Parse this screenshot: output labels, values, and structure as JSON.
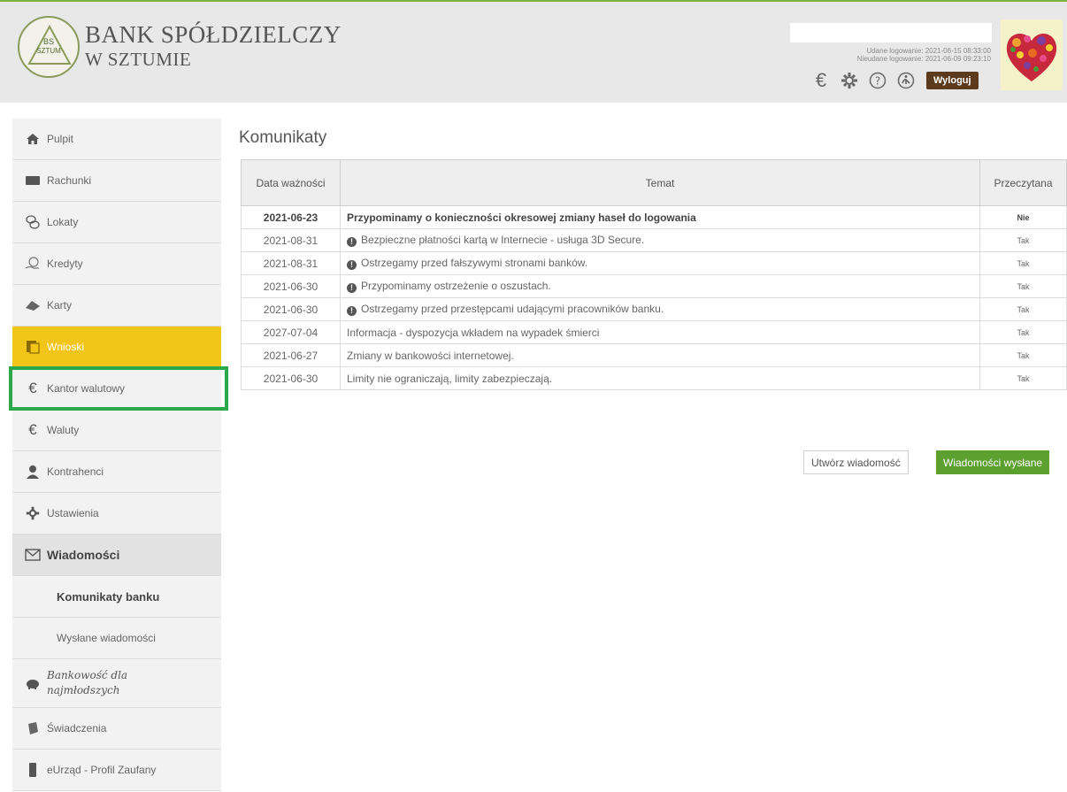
{
  "header": {
    "logo_line1": "BS",
    "logo_line2": "SZTUM",
    "bank_name_line1": "BANK SPÓŁDZIELCZY",
    "bank_name_line2": "W SZTUMIE",
    "login_success": "Udane logowanie: 2021-06-15 08:33:00",
    "login_failed": "Nieudane logowanie: 2021-06-09 09:23:10",
    "logout_label": "Wyloguj",
    "icons": [
      "euro-icon",
      "gear-icon",
      "help-icon",
      "accessibility-icon"
    ]
  },
  "sidebar": {
    "items": [
      {
        "label": "Pulpit",
        "icon": "home-icon"
      },
      {
        "label": "Rachunki",
        "icon": "wallet-icon"
      },
      {
        "label": "Lokaty",
        "icon": "coins-icon"
      },
      {
        "label": "Kredyty",
        "icon": "hand-coins-icon"
      },
      {
        "label": "Karty",
        "icon": "card-icon"
      },
      {
        "label": "Wnioski",
        "icon": "forms-icon"
      },
      {
        "label": "Kantor walutowy",
        "icon": "euro-icon"
      },
      {
        "label": "Waluty",
        "icon": "euro-icon"
      },
      {
        "label": "Kontrahenci",
        "icon": "users-icon"
      },
      {
        "label": "Ustawienia",
        "icon": "gear-icon"
      },
      {
        "label": "Wiadomości",
        "icon": "envelope-icon"
      },
      {
        "label": "Komunikaty banku"
      },
      {
        "label": "Wysłane wiadomości"
      },
      {
        "label": "Bankowość dla najmłodszych",
        "icon": "piggy-icon"
      },
      {
        "label": "Świadczenia",
        "icon": "document-icon"
      },
      {
        "label": "eUrząd - Profil Zaufany",
        "icon": "phone-icon"
      }
    ],
    "active_color": "#f2c618",
    "highlight_frame_color": "#2aa84a"
  },
  "main": {
    "title": "Komunikaty",
    "columns": [
      "Data ważności",
      "Temat",
      "Przeczytana"
    ],
    "rows": [
      {
        "date": "2021-06-23",
        "subject": "Przypominamy o konieczności okresowej zmiany haseł do logowania",
        "read": "Nie",
        "unread": true,
        "important": false
      },
      {
        "date": "2021-08-31",
        "subject": "Bezpieczne płatności kartą w Internecie - usługa 3D Secure.",
        "read": "Tak",
        "unread": false,
        "important": true
      },
      {
        "date": "2021-08-31",
        "subject": "Ostrzegamy przed fałszywymi stronami banków.",
        "read": "Tak",
        "unread": false,
        "important": true
      },
      {
        "date": "2021-06-30",
        "subject": "Przypominamy ostrzeżenie o oszustach.",
        "read": "Tak",
        "unread": false,
        "important": true
      },
      {
        "date": "2021-06-30",
        "subject": "Ostrzegamy przed przestępcami udającymi pracowników banku.",
        "read": "Tak",
        "unread": false,
        "important": true
      },
      {
        "date": "2027-07-04",
        "subject": "Informacja - dyspozycja wkładem na wypadek śmierci",
        "read": "Tak",
        "unread": false,
        "important": false
      },
      {
        "date": "2021-06-27",
        "subject": "Zmiany w bankowości internetowej.",
        "read": "Tak",
        "unread": false,
        "important": false
      },
      {
        "date": "2021-06-30",
        "subject": "Limity nie ograniczają, limity zabezpieczają.",
        "read": "Tak",
        "unread": false,
        "important": false
      }
    ],
    "btn_new": "Utwórz wiadomość",
    "btn_sent": "Wiadomości wysłane",
    "sent_color": "#5ca02f"
  }
}
